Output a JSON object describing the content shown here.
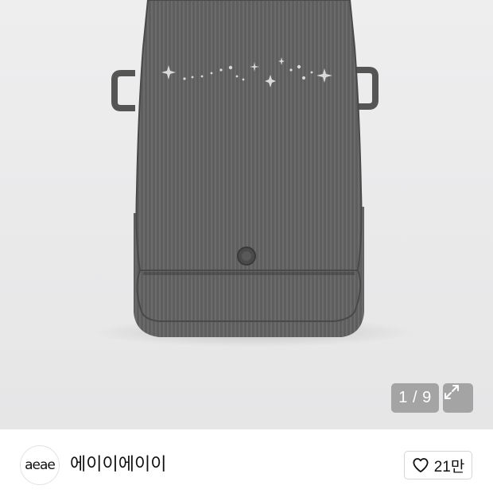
{
  "gallery": {
    "current": "1",
    "separator": "/",
    "total": "9",
    "counter_text": "1 / 9",
    "expand_icon": "expand-arrows-icon"
  },
  "seller": {
    "avatar_text": "aeae",
    "name": "에이이에이이"
  },
  "like": {
    "icon": "heart-outline-icon",
    "count": "21만"
  },
  "colors": {
    "overlay": "#6e6e6e",
    "bag": "#5f5e5e",
    "background": "#ececed"
  }
}
